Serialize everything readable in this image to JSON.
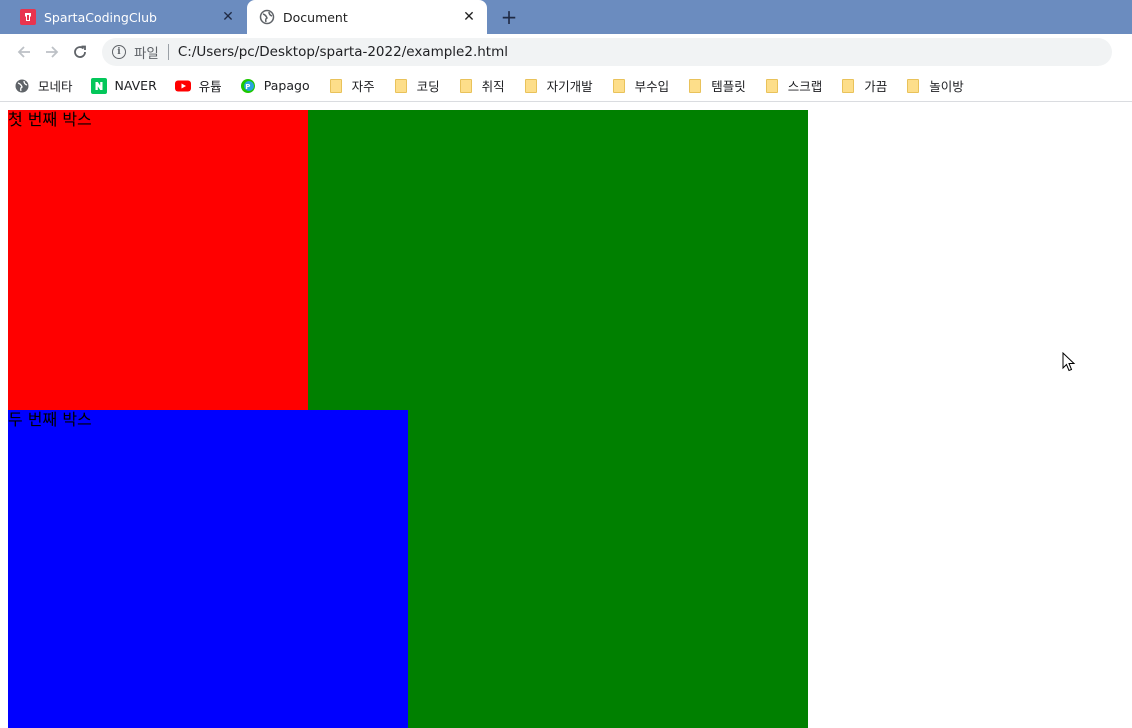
{
  "tabs": [
    {
      "title": "SpartaCodingClub",
      "active": false,
      "favicon": "sparta-logo-icon"
    },
    {
      "title": "Document",
      "active": true,
      "favicon": "globe-icon"
    }
  ],
  "toolbar": {
    "scheme_label": "파일",
    "url": "C:/Users/pc/Desktop/sparta-2022/example2.html"
  },
  "bookmarks": [
    {
      "label": "모네타",
      "icon": "globe-icon"
    },
    {
      "label": "NAVER",
      "icon": "naver-icon"
    },
    {
      "label": "유튭",
      "icon": "youtube-icon"
    },
    {
      "label": "Papago",
      "icon": "papago-icon"
    },
    {
      "label": "자주",
      "icon": "folder-icon"
    },
    {
      "label": "코딩",
      "icon": "folder-icon"
    },
    {
      "label": "취직",
      "icon": "folder-icon"
    },
    {
      "label": "자기개발",
      "icon": "folder-icon"
    },
    {
      "label": "부수입",
      "icon": "folder-icon"
    },
    {
      "label": "템플릿",
      "icon": "folder-icon"
    },
    {
      "label": "스크랩",
      "icon": "folder-icon"
    },
    {
      "label": "가끔",
      "icon": "folder-icon"
    },
    {
      "label": "놀이방",
      "icon": "folder-icon"
    }
  ],
  "page": {
    "first_box_text": "첫 번째 박스",
    "second_box_text": "두 번째 박스"
  },
  "colors": {
    "tabstrip": "#6b8cbf",
    "green_box": "#008000",
    "red_box": "#ff0000",
    "blue_box": "#0000ff"
  }
}
